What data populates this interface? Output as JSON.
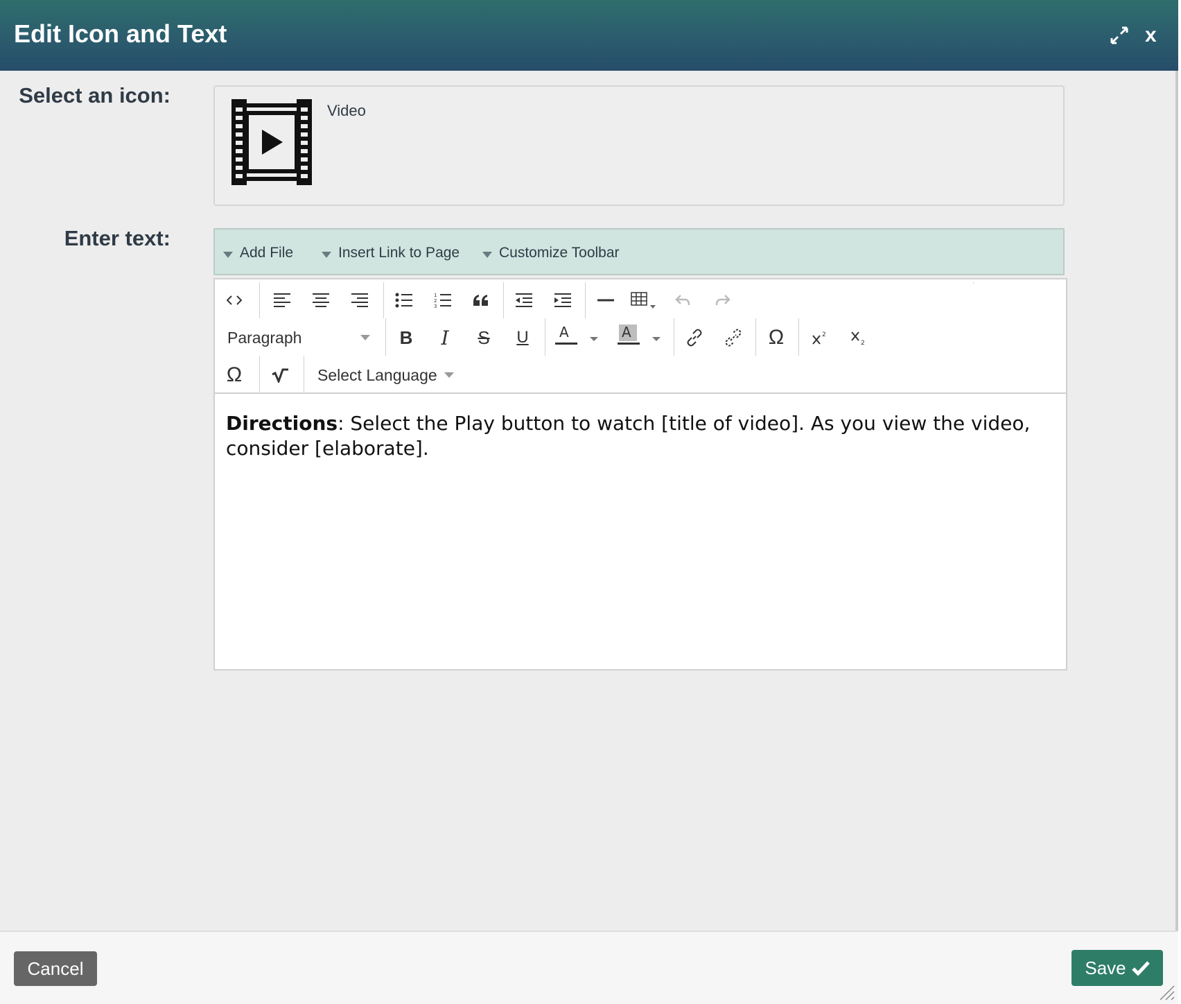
{
  "dialog": {
    "title": "Edit Icon and Text",
    "close_label": "x"
  },
  "icon_section": {
    "label": "Select an icon:",
    "icon_name": "Video",
    "icon": "film-play-icon"
  },
  "text_section": {
    "label": "Enter text:"
  },
  "tool_strip": {
    "items": [
      {
        "label": "Add File"
      },
      {
        "label": "Insert Link to Page"
      },
      {
        "label": "Customize Toolbar"
      }
    ]
  },
  "editor": {
    "paragraph_select": "Paragraph",
    "language_select": "Select Language",
    "content": {
      "bold": "Directions",
      "rest": ": Select the Play button to watch [title of video]. As you view the video, consider [elaborate]."
    }
  },
  "footer": {
    "cancel_label": "Cancel",
    "save_label": "Save"
  },
  "colors": {
    "title_bar": "#2b5a6d",
    "tool_strip": "#d1e5e0",
    "save_button": "#2e7d67",
    "cancel_button": "#666666"
  }
}
